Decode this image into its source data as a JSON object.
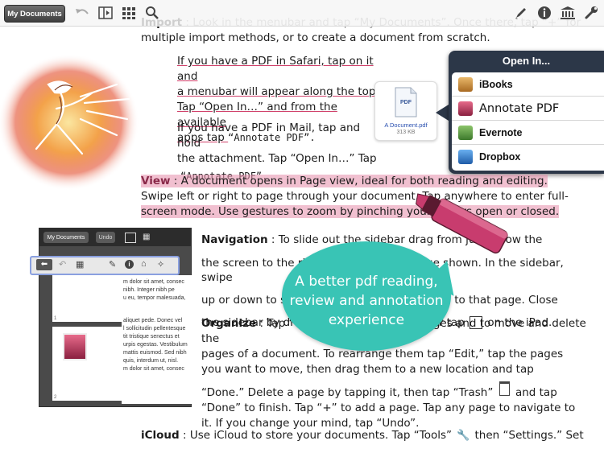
{
  "toolbar": {
    "my_documents_label": "My Documents",
    "icons": [
      "undo-icon",
      "sidebar-icon",
      "grid-icon",
      "search-icon",
      "pencil-icon",
      "info-icon",
      "library-icon",
      "tools-icon"
    ]
  },
  "document": {
    "import_title": "Import",
    "import_text": " : Look in the menubar and tap “My Documents”. Once there, tap “+” for",
    "import_text2": "multiple import methods, or to create a document from scratch.",
    "safari_lines": [
      "If you have a PDF in Safari, tap on it and",
      "a menubar will appear along the top.",
      "Tap “Open In…” and from the available",
      "apps tap "
    ],
    "safari_annotate": "“Annotate PDF”.",
    "mail_lines": [
      "If you have a PDF in Mail, tap and hold",
      "the attachment. Tap “Open In…”  Tap"
    ],
    "mail_annotate": "“Annotate PDF”.",
    "view_title": "View",
    "view_lines": [
      " : A document opens in Page view, ideal for both reading and editing.",
      "Swipe left or right to page through your document. Tap anywhere to enter full-",
      "screen mode. Use gestures to zoom by pinching your fingers open or closed."
    ],
    "nav_title": "Navigation",
    "nav_lines": [
      " : To slide out the sidebar drag from just below the",
      "the screen to the right. Tap to select a page shown. In the sidebar, swipe",
      "up or down to scroll, then tap on a page to go to that page. Close",
      "the sidebar by dragging it back to the left or tap",
      "on the iPad."
    ],
    "org_title": "Organize",
    "org_lines": [
      " : Tap “Thumbnails” to see all pages and to move and delete the",
      "pages of a document. To rearrange them tap “Edit,” tap the pages",
      "you want to move, then drag them to a new location and tap",
      "“Done.” Delete a page by tapping it, then tap “Trash”",
      "and tap",
      "“Done” to finish. Tap “+” to add a page. Tap any page to navigate to",
      "it. If you change your mind, tap “Undo”."
    ],
    "icloud_title": "iCloud",
    "icloud_text": " : Use iCloud to store your documents. Tap “Tools”",
    "icloud_text2": "then “Settings.” Set"
  },
  "open_in": {
    "title": "Open In...",
    "items": [
      {
        "label": "iBooks",
        "icon": "ibooks-icon",
        "color": "#b5782b"
      },
      {
        "label": "Annotate PDF",
        "icon": "annotate-pdf-icon",
        "color": "#b03050"
      },
      {
        "label": "Evernote",
        "icon": "evernote-icon",
        "color": "#4a8a3a"
      },
      {
        "label": "Dropbox",
        "icon": "dropbox-icon",
        "color": "#2f78c8"
      }
    ]
  },
  "file": {
    "name": "A Document.pdf",
    "size": "313 KB",
    "badge": "PDF"
  },
  "mini_screen": {
    "my_documents": "My Documents",
    "undo": "Undo",
    "text_lines": [
      "m dolor sit amet, consec",
      "nibh. Integer nibh pe",
      "u eu, tempor malesuada,",
      "aliquet pede. Donec vel",
      "l sollicitudin pellentesque",
      "tit tristique senectus et",
      "urpis egestas. Vestibulum",
      "mattis euismod. Sed nibh",
      "quis, interdum ut, nisl.",
      "m dolor sit amet, consec"
    ],
    "page_numbers": [
      "1",
      "2"
    ]
  },
  "bubble": {
    "lines": [
      "A better pdf reading,",
      "review and annotation",
      "experience"
    ]
  },
  "colors": {
    "highlight": "#e68caa",
    "bubble": "#39c4b5",
    "marker": "#c83c6e",
    "popover": "#2c3748"
  }
}
